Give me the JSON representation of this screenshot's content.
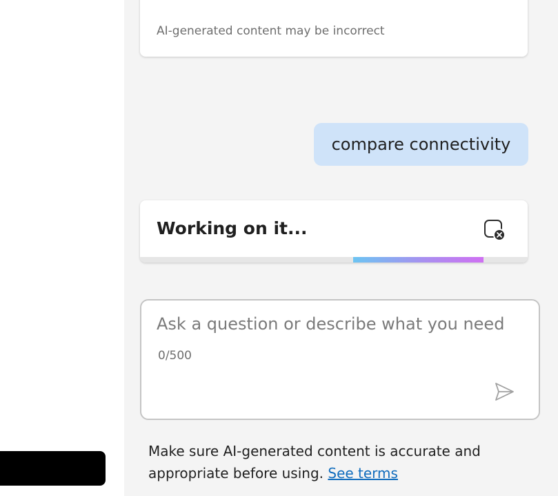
{
  "previous_response": {
    "disclaimer": "AI-generated content may be incorrect"
  },
  "conversation": {
    "user_message": "compare connectivity"
  },
  "status_card": {
    "text": "Working on it...",
    "stop_icon": "stop-generating-icon",
    "progress_start": 0.55,
    "progress_end": 0.887
  },
  "composer": {
    "placeholder": "Ask a question or describe what you need",
    "value": "",
    "char_count": "0/500",
    "send_icon": "send-icon"
  },
  "footer": {
    "note": "Make sure AI-generated content is accurate and appropriate before using.",
    "link_label": "See terms"
  },
  "colors": {
    "user_bubble": "#cfe3f9",
    "pane_background": "#f4f4f4",
    "link": "#0f6cbd",
    "progress_start_color": "#6cc4f2",
    "progress_end_color": "#cf70f2"
  }
}
